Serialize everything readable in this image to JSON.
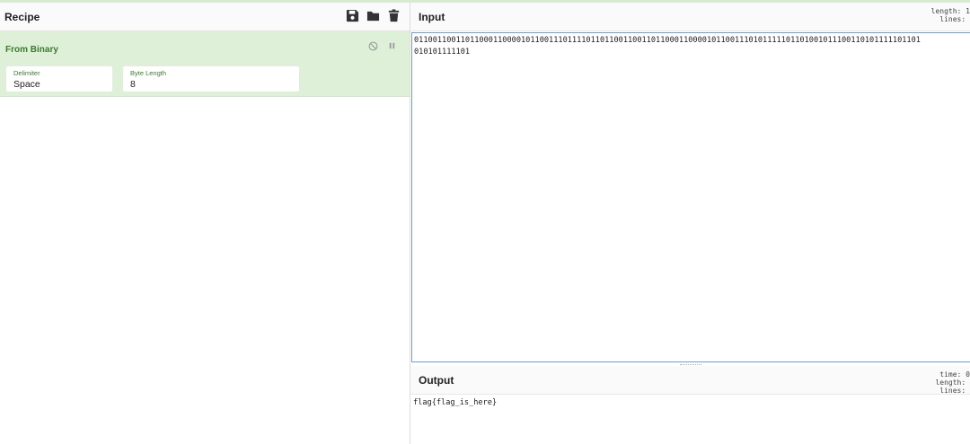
{
  "recipe": {
    "title": "Recipe",
    "controls": [
      "save-icon",
      "folder-icon",
      "trash-icon"
    ],
    "operation": {
      "name": "From Binary",
      "controls": [
        "disable-icon",
        "pause-icon"
      ],
      "args": {
        "delimiter_label": "Delimiter",
        "delimiter_value": "Space",
        "byte_length_label": "Byte Length",
        "byte_length_value": "8"
      }
    }
  },
  "input": {
    "title": "Input",
    "stats": "length: 1\n lines: ",
    "text": "0110011001101100011000010110011101111011011001100110110001100001011001110101111101101001011100110101111101101\n010101111101"
  },
  "output": {
    "title": "Output",
    "stats": "  time: 0\nlength: \n lines: ",
    "text": "flag{flag_is_here}"
  },
  "colors": {
    "operation_bg": "#dff0d8",
    "operation_text": "#3c7a2e",
    "input_border": "#6a9cd8"
  }
}
